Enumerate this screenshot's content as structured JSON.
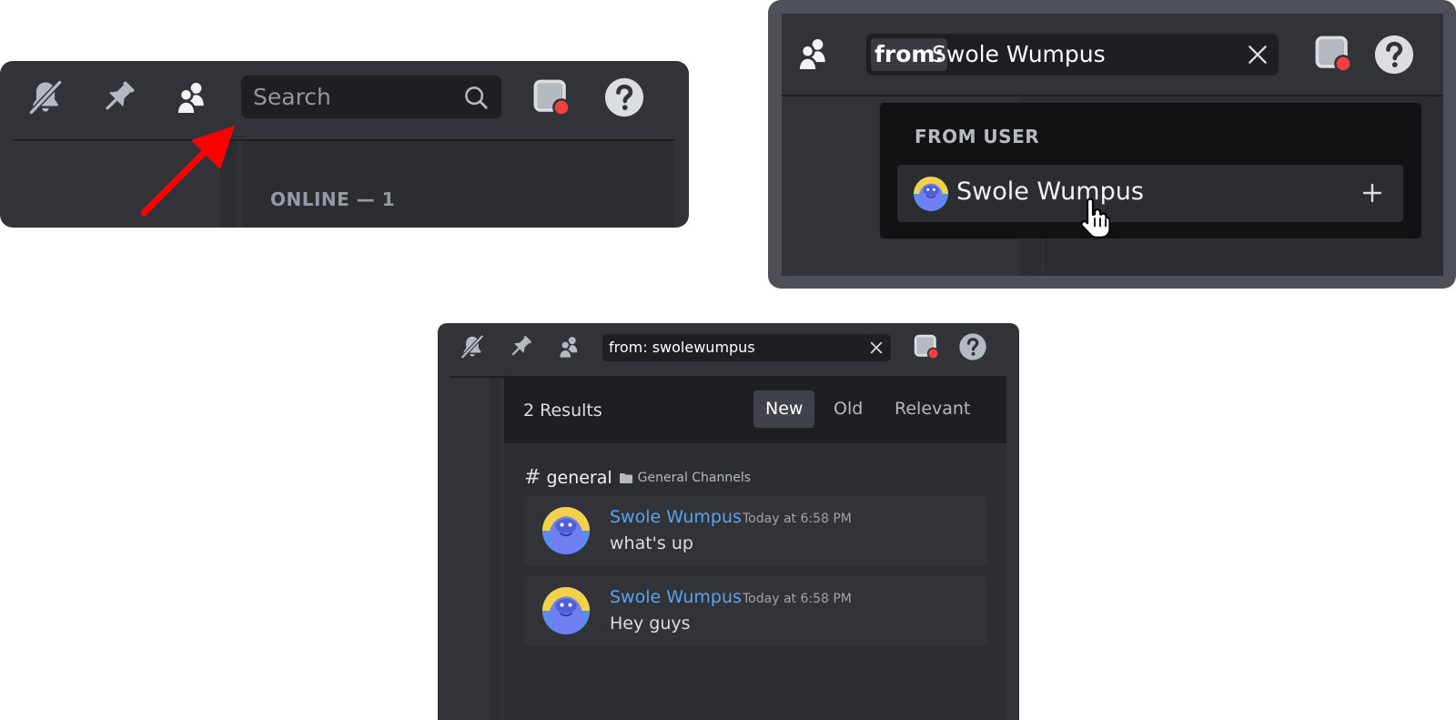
{
  "panel_a": {
    "search": {
      "placeholder": "Search"
    },
    "members_header": "ONLINE — 1",
    "icons": [
      "bell-slash-icon",
      "pin-icon",
      "members-icon",
      "search-icon",
      "inbox-icon",
      "help-icon"
    ]
  },
  "panel_b": {
    "search": {
      "chip": "from:",
      "value": "Swole Wumpus"
    },
    "popout": {
      "title": "FROM USER",
      "option": {
        "name": "Swole Wumpus"
      }
    },
    "icons": [
      "members-icon",
      "close-icon",
      "inbox-icon",
      "help-icon",
      "plus-icon",
      "hand-cursor-icon"
    ]
  },
  "panel_c": {
    "search": {
      "value": "from: swolewumpus"
    },
    "results": {
      "count": "2 Results",
      "sort_tabs": [
        {
          "label": "New",
          "active": true
        },
        {
          "label": "Old",
          "active": false
        },
        {
          "label": "Relevant",
          "active": false
        }
      ],
      "channel": {
        "hash": "#",
        "name": "general",
        "category": "General Channels"
      },
      "messages": [
        {
          "author": "Swole Wumpus",
          "time": "Today at 6:58 PM",
          "text": "what's up"
        },
        {
          "author": "Swole Wumpus",
          "time": "Today at 6:58 PM",
          "text": "Hey guys"
        }
      ]
    }
  },
  "colors": {
    "background": "#313338",
    "search_bg": "#1e1f22",
    "author_blue": "#5aa3ef",
    "arrow_red": "#ff0000",
    "notification_red": "#f23f43"
  }
}
